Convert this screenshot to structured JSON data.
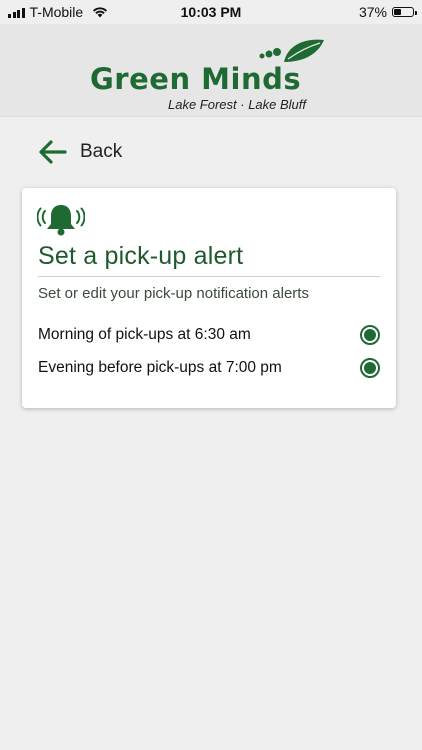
{
  "status": {
    "carrier": "T-Mobile",
    "time": "10:03 PM",
    "battery": "37%",
    "battery_level": 0.37
  },
  "header": {
    "logo_title": "Green Minds",
    "logo_subtitle": "Lake Forest · Lake Bluff"
  },
  "nav": {
    "back_label": "Back"
  },
  "alert_card": {
    "icon": "bell-ringing-icon",
    "title": "Set a pick-up alert",
    "subtitle": "Set or edit your pick-up notification alerts",
    "options": [
      {
        "label": "Morning of pick-ups at 6:30 am",
        "selected": true
      },
      {
        "label": "Evening before pick-ups at 7:00 pm",
        "selected": true
      }
    ]
  },
  "colors": {
    "brand_green": "#1f6a33",
    "background": "#efefef",
    "header_bg": "#e6e6e6"
  }
}
